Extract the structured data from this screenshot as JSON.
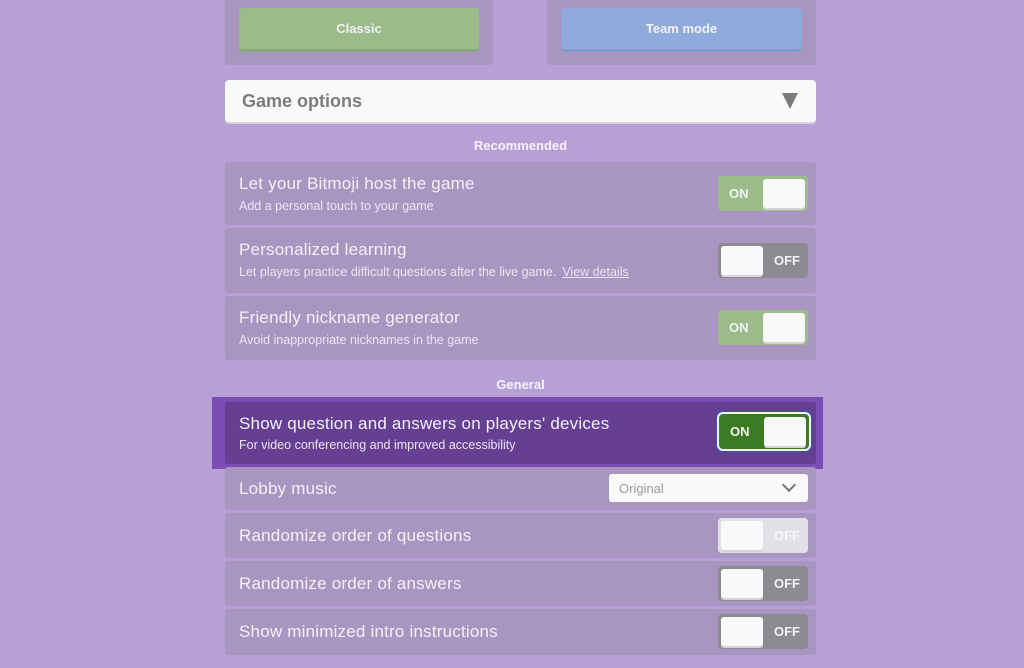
{
  "modes": {
    "classic_label": "Classic",
    "team_label": "Team mode"
  },
  "game_options": {
    "title": "Game options",
    "expand_icon": "triangle-down-icon"
  },
  "sections": {
    "recommended": "Recommended",
    "general": "General"
  },
  "recommended_options": [
    {
      "label": "Let your Bitmoji host the game",
      "sub": "Add a personal touch to your game",
      "state": "ON"
    },
    {
      "label": "Personalized learning",
      "sub": "Let players practice difficult questions after the live game.",
      "link": "View details",
      "state": "OFF"
    },
    {
      "label": "Friendly nickname generator",
      "sub": "Avoid inappropriate nicknames in the game",
      "state": "ON"
    }
  ],
  "general_options": [
    {
      "label": "Show question and answers on players' devices",
      "sub": "For video conferencing and improved accessibility",
      "state": "ON",
      "highlighted": true
    },
    {
      "label": "Lobby music",
      "select_value": "Original"
    },
    {
      "label": "Randomize order of questions",
      "state": "OFF",
      "disabled": true
    },
    {
      "label": "Randomize order of answers",
      "state": "OFF"
    },
    {
      "label": "Show minimized intro instructions",
      "state": "OFF"
    }
  ],
  "colors": {
    "background": "#b6a0d6",
    "row": "#a996c0",
    "toggle_on": "#9bbb8a",
    "toggle_off": "#8d8a91",
    "highlight": "#643f92",
    "highlight_toggle_on": "#3d7a24"
  }
}
